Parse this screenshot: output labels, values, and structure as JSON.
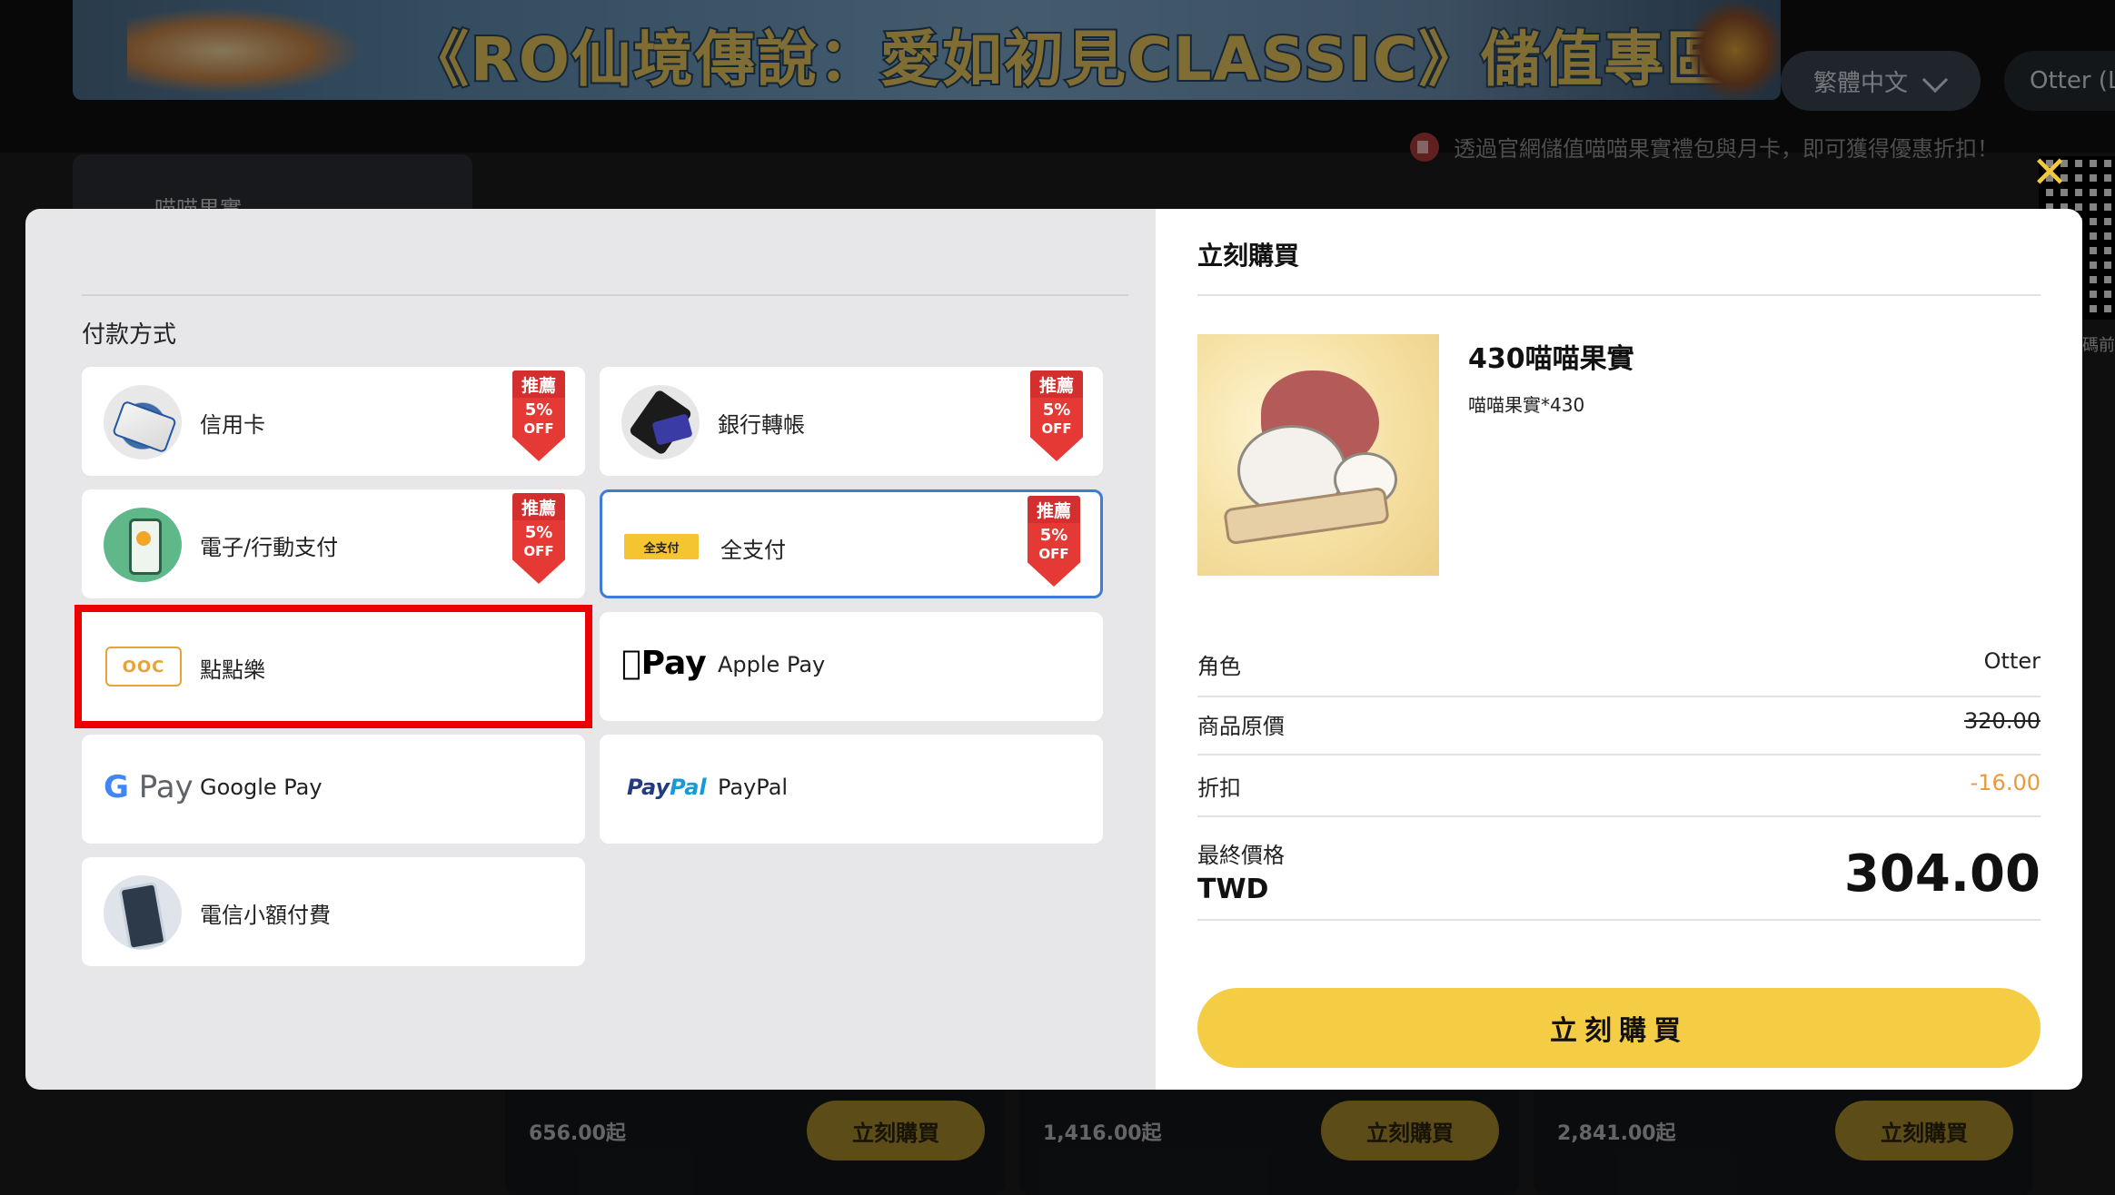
{
  "header": {
    "banner_title": "《RO仙境傳說：愛如初見CLASSIC》儲值專區",
    "banner_logo_text": "仙境傳說",
    "language": "繁體中文",
    "user_name": "Otter (Lv"
  },
  "notice": {
    "text": "透過官網儲值喵喵果實禮包與月卡，即可獲得優惠折扣！"
  },
  "sidebar": {
    "active_tab": "喵喵果實"
  },
  "qr": {
    "caption": "碼前"
  },
  "background_cards": [
    {
      "price": "656.00起",
      "buy_label": "立刻購買"
    },
    {
      "price": "1,416.00起",
      "buy_label": "立刻購買"
    },
    {
      "price": "2,841.00起",
      "buy_label": "立刻購買"
    }
  ],
  "payment": {
    "section_title": "付款方式",
    "badge": {
      "top": "推薦",
      "pct": "5%",
      "off": "OFF"
    },
    "methods": [
      {
        "label": "信用卡",
        "icon": "credit-card-icon",
        "recommended": true
      },
      {
        "label": "銀行轉帳",
        "icon": "bank-transfer-icon",
        "recommended": true
      },
      {
        "label": "電子/行動支付",
        "icon": "mobile-payment-icon",
        "recommended": true
      },
      {
        "label": "全支付",
        "icon": "quanzhifu-logo-icon",
        "icon_text": "全支付",
        "recommended": true,
        "selected": true
      },
      {
        "label": "點點樂",
        "icon": "ooc-logo-icon",
        "icon_text": "OOC",
        "recommended": false,
        "highlighted": true
      },
      {
        "label": "Apple Pay",
        "icon": "apple-pay-logo-icon",
        "icon_text": "Pay",
        "recommended": false
      },
      {
        "label": "Google Pay",
        "icon": "google-pay-logo-icon",
        "icon_text_g": "G",
        "icon_text": "Pay",
        "recommended": false
      },
      {
        "label": "PayPal",
        "icon": "paypal-logo-icon",
        "icon_text_pay": "Pay",
        "icon_text_pal": "Pal",
        "recommended": false
      },
      {
        "label": "電信小額付費",
        "icon": "telecom-billing-icon",
        "recommended": false
      }
    ]
  },
  "purchase": {
    "title": "立刻購買",
    "product_name": "430喵喵果實",
    "product_sub": "喵喵果實*430",
    "rows": {
      "role_label": "角色",
      "role_value": "Otter",
      "original_label": "商品原價",
      "original_value": "320.00",
      "discount_label": "折扣",
      "discount_value": "-16.00",
      "final_label": "最終價格",
      "currency": "TWD",
      "final_value": "304.00"
    },
    "buy_label": "立刻購買"
  },
  "colors": {
    "accent_yellow": "#f5cd44",
    "selected_border": "#3f7bd8",
    "highlight_red": "#ee0000",
    "discount_orange": "#e99a3c",
    "badge_red": "#e53935"
  }
}
